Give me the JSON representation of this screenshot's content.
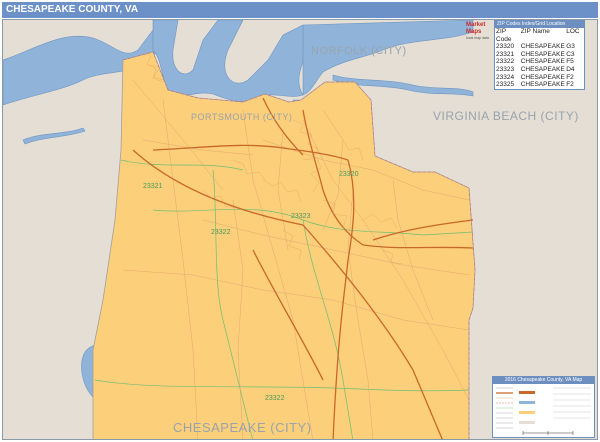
{
  "title": "CHESAPEAKE COUNTY, VA",
  "map": {
    "city_labels": [
      {
        "id": "norfolk",
        "text": "NORFOLK (CITY)"
      },
      {
        "id": "portsmouth",
        "text": "PORTSMOUTH (CITY)"
      },
      {
        "id": "virginia-beach",
        "text": "VIRGINIA BEACH (CITY)"
      },
      {
        "id": "chesapeake",
        "text": "CHESAPEAKE (CITY)"
      }
    ],
    "zip_labels": [
      "23321",
      "23320",
      "23322",
      "23323",
      "23322"
    ],
    "colors": {
      "county_fill": "#fccf7a",
      "surrounding_land": "#e4ded4",
      "water": "#8fb3d9",
      "highway": "#c8682a",
      "road": "#e0a070",
      "zip_boundary": "#6fbf73"
    }
  },
  "logo": {
    "text": "Market Maps",
    "subtitle": "local map data"
  },
  "zip_table": {
    "title": "ZIP Codes Index/Grid Location",
    "headers": [
      "ZIP Code",
      "ZIP Name",
      "LOC"
    ],
    "rows": [
      [
        "23320",
        "CHESAPEAKE",
        "G3"
      ],
      [
        "23321",
        "CHESAPEAKE",
        "C3"
      ],
      [
        "23322",
        "CHESAPEAKE",
        "F5"
      ],
      [
        "23323",
        "CHESAPEAKE",
        "D4"
      ],
      [
        "23324",
        "CHESAPEAKE",
        "F2"
      ],
      [
        "23325",
        "CHESAPEAKE",
        "F2"
      ]
    ]
  },
  "legend": {
    "title": "2016 Chesapeake County, VA Map"
  }
}
